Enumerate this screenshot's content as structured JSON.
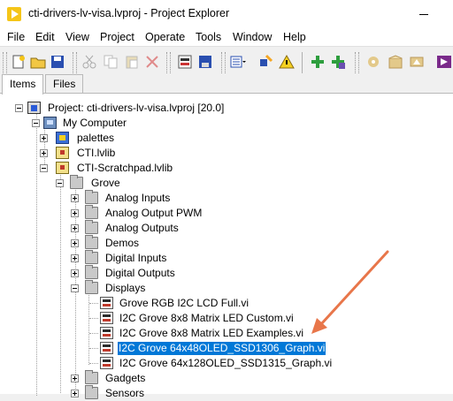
{
  "window": {
    "title": "cti-drivers-lv-visa.lvproj - Project Explorer"
  },
  "menu": [
    "File",
    "Edit",
    "View",
    "Project",
    "Operate",
    "Tools",
    "Window",
    "Help"
  ],
  "toolbar": {
    "buttons": [
      "new-icon",
      "open-icon",
      "save-all-icon",
      "cut-icon",
      "copy-icon",
      "paste-icon",
      "delete-icon",
      "build-icon",
      "save-icon",
      "view-dropdown-icon",
      "resolve-icon",
      "warning-icon",
      "add-icon",
      "add-green-icon",
      "gear-icon",
      "package-icon",
      "lv-icon"
    ]
  },
  "tabs": [
    "Items",
    "Files"
  ],
  "tree": [
    {
      "label": "Project: cti-drivers-lv-visa.lvproj [20.0]",
      "icon": "project-icon",
      "level": 0,
      "expander": "minus"
    },
    {
      "label": "My Computer",
      "icon": "computer-icon",
      "level": 1,
      "expander": "minus"
    },
    {
      "label": "palettes",
      "icon": "palette-library-icon",
      "level": 2,
      "expander": "plus"
    },
    {
      "label": "CTI.lvlib",
      "icon": "library-icon",
      "level": 2,
      "expander": "plus"
    },
    {
      "label": "CTI-Scratchpad.lvlib",
      "icon": "library-icon",
      "level": 2,
      "expander": "minus"
    },
    {
      "label": "Grove",
      "icon": "folder-icon",
      "level": 3,
      "expander": "minus"
    },
    {
      "label": "Analog Inputs",
      "icon": "folder-icon",
      "level": 4,
      "expander": "plus"
    },
    {
      "label": "Analog Output PWM",
      "icon": "folder-icon",
      "level": 4,
      "expander": "plus"
    },
    {
      "label": "Analog Outputs",
      "icon": "folder-icon",
      "level": 4,
      "expander": "plus"
    },
    {
      "label": "Demos",
      "icon": "folder-icon",
      "level": 4,
      "expander": "plus"
    },
    {
      "label": "Digital Inputs",
      "icon": "folder-icon",
      "level": 4,
      "expander": "plus"
    },
    {
      "label": "Digital Outputs",
      "icon": "folder-icon",
      "level": 4,
      "expander": "plus"
    },
    {
      "label": "Displays",
      "icon": "folder-icon",
      "level": 4,
      "expander": "minus"
    },
    {
      "label": "Grove RGB I2C LCD Full.vi",
      "icon": "vi-icon",
      "level": 5,
      "expander": ""
    },
    {
      "label": "I2C Grove 8x8 Matrix LED Custom.vi",
      "icon": "vi-icon",
      "level": 5,
      "expander": ""
    },
    {
      "label": "I2C Grove 8x8 Matrix LED Examples.vi",
      "icon": "vi-icon",
      "level": 5,
      "expander": ""
    },
    {
      "label": "I2C Grove 64x48OLED_SSD1306_Graph.vi",
      "icon": "vi-icon",
      "level": 5,
      "expander": "",
      "selected": true
    },
    {
      "label": "I2C Grove 64x128OLED_SSD1315_Graph.vi",
      "icon": "vi-icon",
      "level": 5,
      "expander": ""
    },
    {
      "label": "Gadgets",
      "icon": "folder-icon",
      "level": 4,
      "expander": "plus"
    },
    {
      "label": "Sensors",
      "icon": "folder-icon",
      "level": 4,
      "expander": "plus"
    }
  ],
  "annotation": {
    "arrow_color": "#e8764a"
  }
}
